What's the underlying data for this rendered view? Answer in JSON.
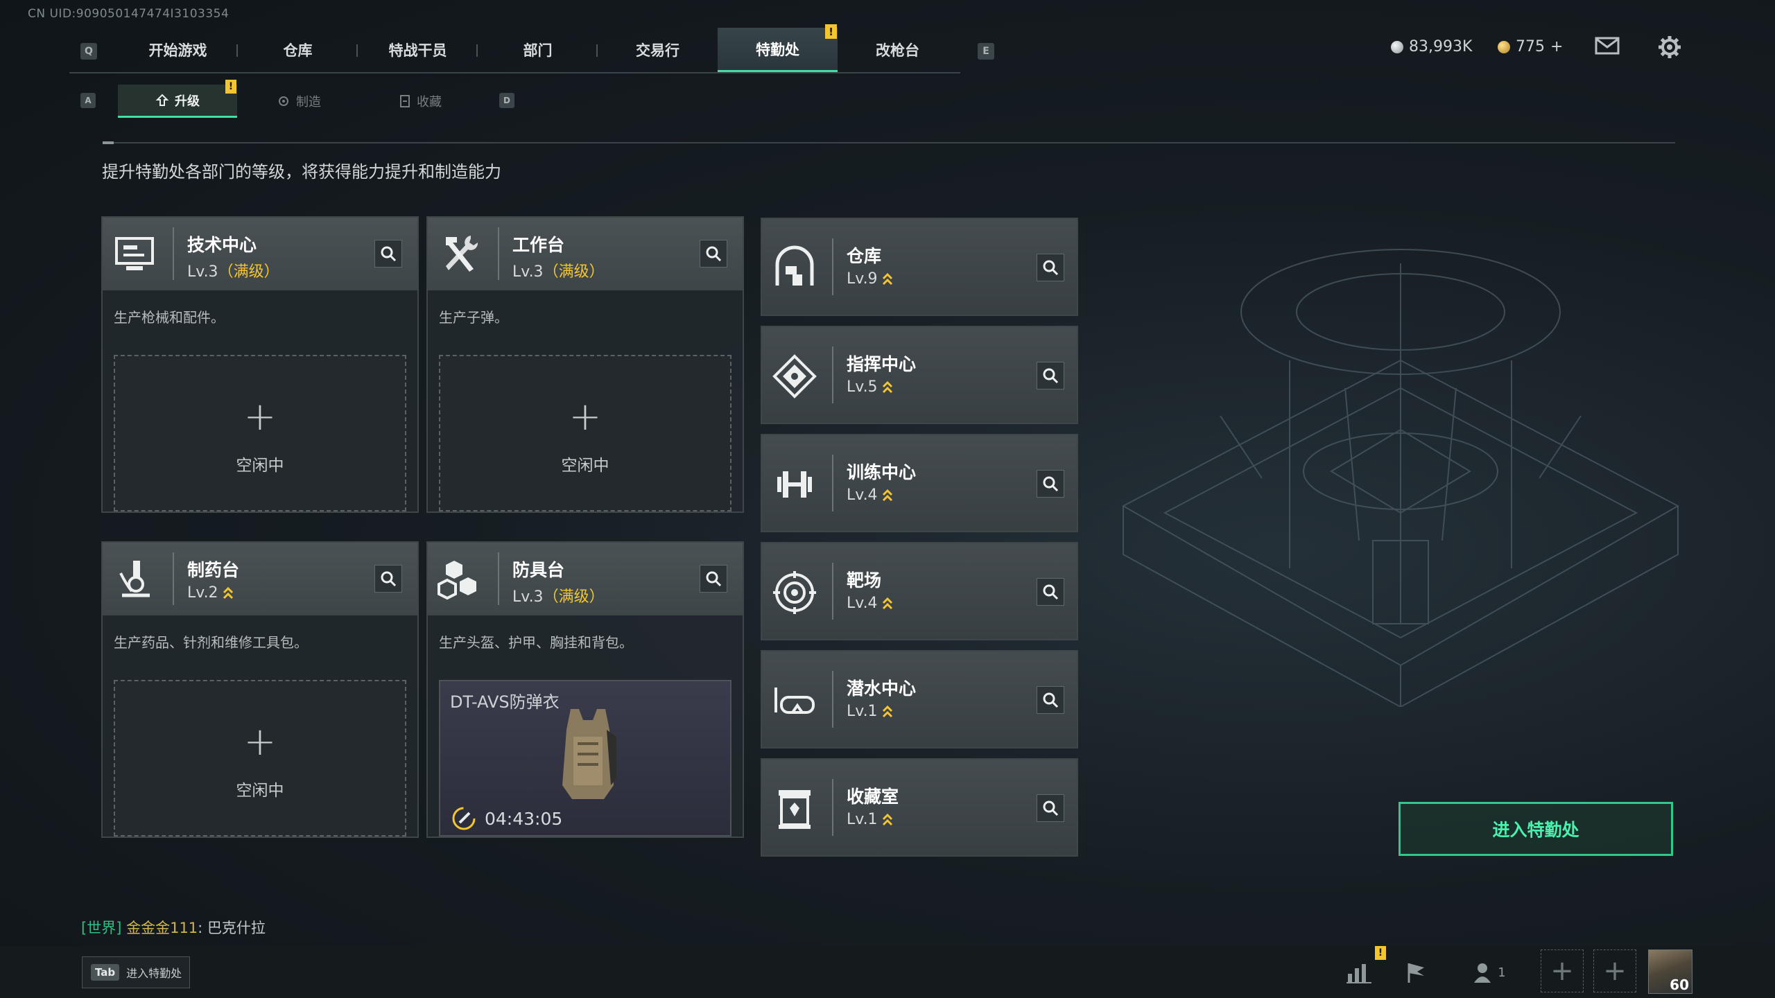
{
  "uid": "CN UID:909050147474I3103354",
  "top_nav": {
    "left_key": "Q",
    "right_key": "E",
    "tabs": [
      {
        "label": "开始游戏"
      },
      {
        "label": "仓库"
      },
      {
        "label": "特战干员"
      },
      {
        "label": "部门"
      },
      {
        "label": "交易行"
      },
      {
        "label": "特勤处",
        "active": true,
        "badge": "!"
      },
      {
        "label": "改枪台"
      }
    ]
  },
  "currency": {
    "silver": "83,993K",
    "gold": "775",
    "gold_add": "+"
  },
  "sub_nav": {
    "left_key": "A",
    "right_key": "D",
    "tabs": [
      {
        "label": "升级",
        "active": true,
        "badge": "!"
      },
      {
        "label": "制造"
      },
      {
        "label": "收藏"
      }
    ]
  },
  "hint": "提升特勤处各部门的等级，将获得能力提升和制造能力",
  "workshops": [
    {
      "title": "技术中心",
      "level": "Lv.3",
      "max": "（满级）",
      "desc": "生产枪械和配件。",
      "slot": {
        "plus": "+",
        "status": "空闲中"
      }
    },
    {
      "title": "工作台",
      "level": "Lv.3",
      "max": "（满级）",
      "desc": "生产子弹。",
      "slot": {
        "plus": "+",
        "status": "空闲中"
      }
    },
    {
      "title": "制药台",
      "level": "Lv.2",
      "desc": "生产药品、针剂和维修工具包。",
      "slot": {
        "plus": "+",
        "status": "空闲中"
      }
    },
    {
      "title": "防具台",
      "level": "Lv.3",
      "max": "（满级）",
      "desc": "生产头盔、护甲、胸挂和背包。",
      "craft": {
        "item": "DT-AVS防弹衣",
        "timer": "04:43:05"
      }
    }
  ],
  "departments": [
    {
      "title": "仓库",
      "level": "Lv.9",
      "icon": "vault-icon"
    },
    {
      "title": "指挥中心",
      "level": "Lv.5",
      "icon": "command-icon"
    },
    {
      "title": "训练中心",
      "level": "Lv.4",
      "icon": "dumbbell-icon"
    },
    {
      "title": "靶场",
      "level": "Lv.4",
      "icon": "target-icon"
    },
    {
      "title": "潜水中心",
      "level": "Lv.1",
      "icon": "dive-mask-icon"
    },
    {
      "title": "收藏室",
      "level": "Lv.1",
      "icon": "collection-icon"
    }
  ],
  "enter_button": "进入特勤处",
  "chat": {
    "channel": "[世界]",
    "name": "金金金111",
    "sep": ":",
    "message": "巴克什拉"
  },
  "footer": {
    "tab_key": "Tab",
    "tab_label": "进入特勤处",
    "party_count": "1",
    "player_level": "60"
  },
  "colors": {
    "accent": "#3fe0a4",
    "badge": "#f2c531",
    "enter_button": "#2fc98b"
  }
}
